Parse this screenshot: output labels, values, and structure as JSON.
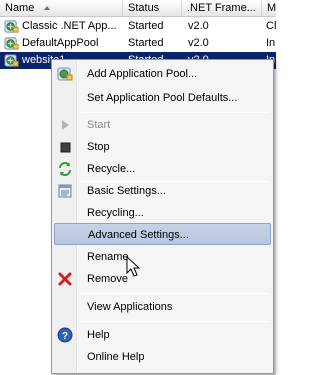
{
  "columns": {
    "name": "Name",
    "status": "Status",
    "framework": ".NET Frame...",
    "more": "M"
  },
  "rows": [
    {
      "name": "Classic .NET App...",
      "status": "Started",
      "framework": "v2.0",
      "more": "Cl"
    },
    {
      "name": "DefaultAppPool",
      "status": "Started",
      "framework": "v2.0",
      "more": "In"
    },
    {
      "name": "website1",
      "status": "Started",
      "framework": "v2.0",
      "more": "In"
    }
  ],
  "menu": {
    "add_pool": "Add Application Pool...",
    "set_defaults": "Set Application Pool Defaults...",
    "start": "Start",
    "stop": "Stop",
    "recycle": "Recycle...",
    "basic_settings": "Basic Settings...",
    "recycling": "Recycling...",
    "advanced_settings": "Advanced Settings...",
    "rename": "Rename",
    "remove": "Remove",
    "view_applications": "View Applications",
    "help": "Help",
    "online_help": "Online Help"
  },
  "colors": {
    "selection": "#0a246a",
    "menu_hover": "#b7c6df",
    "remove_red": "#d21f1f"
  }
}
